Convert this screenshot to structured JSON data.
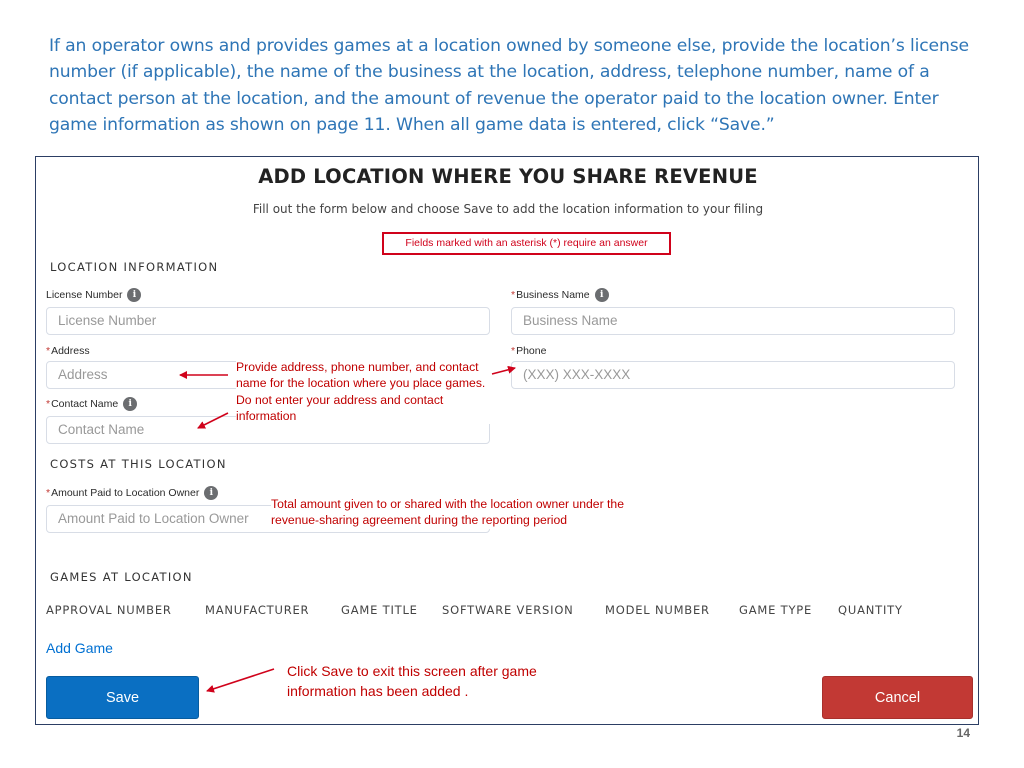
{
  "intro_text": "If an operator owns and provides games at a location owned by someone else, provide the location’s license number (if applicable), the name of the business at the location, address, telephone number, name of a contact person at the location, and the amount of revenue the operator paid to the location owner.  Enter game information as shown on page 11. When all game data is entered, click “Save.”",
  "form": {
    "title": "ADD LOCATION WHERE YOU SHARE REVENUE",
    "subtitle": "Fill out the form below and choose Save to add the location information to your filing",
    "required_note": "Fields marked with an asterisk (*) require an answer",
    "required_marker": "*",
    "info_glyph": "i"
  },
  "location_section": {
    "heading": "LOCATION INFORMATION",
    "license_number": {
      "label": "License Number",
      "placeholder": "License Number",
      "required": false
    },
    "business_name": {
      "label": "Business Name",
      "placeholder": "Business Name",
      "required": true
    },
    "address": {
      "label": "Address",
      "placeholder": "Address",
      "required": true
    },
    "phone": {
      "label": "Phone",
      "placeholder": "(XXX) XXX-XXXX",
      "required": true
    },
    "contact_name": {
      "label": "Contact Name",
      "placeholder": "Contact Name",
      "required": true
    }
  },
  "costs_section": {
    "heading": "COSTS AT THIS LOCATION",
    "amount_paid": {
      "label": "Amount Paid to Location Owner",
      "placeholder": "Amount Paid to Location Owner",
      "required": true
    }
  },
  "games_section": {
    "heading": "GAMES AT LOCATION",
    "columns": [
      "APPROVAL NUMBER",
      "MANUFACTURER",
      "GAME TITLE",
      "SOFTWARE VERSION",
      "MODEL NUMBER",
      "GAME TYPE",
      "QUANTITY"
    ],
    "add_game_label": "Add Game"
  },
  "buttons": {
    "save_label": "Save",
    "cancel_label": "Cancel"
  },
  "callouts": {
    "address_contact": "Provide address, phone number, and contact name for the location where you place games.  Do not enter your address and contact information",
    "amount_paid": "Total amount given to or shared with the location owner under the revenue-sharing agreement during the reporting period",
    "save": "Click Save to exit this screen after game information has been added ."
  },
  "page_number": "14",
  "colors": {
    "intro_text": "#2e75b6",
    "callout_red": "#c00000",
    "save_button": "#0a6fc2",
    "cancel_button": "#c23934",
    "link_blue": "#0070d2"
  },
  "icons": {
    "info": "info-icon",
    "annotation_arrow": "red-arrow"
  }
}
